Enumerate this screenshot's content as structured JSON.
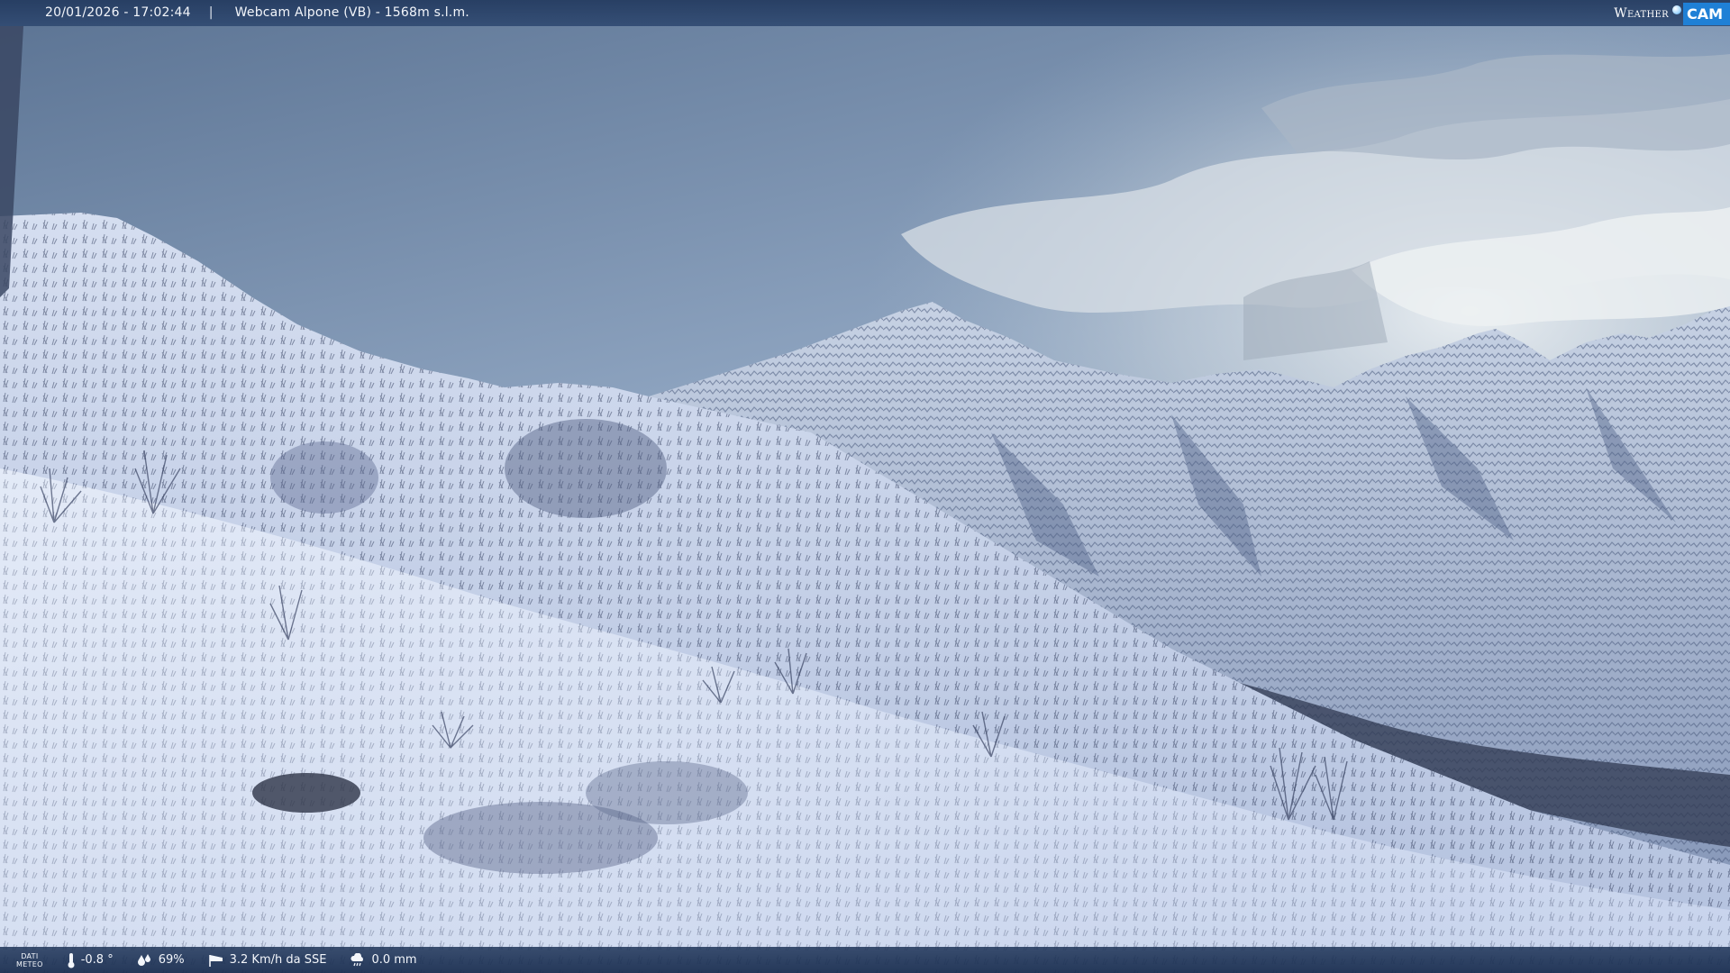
{
  "header": {
    "timestamp": "20/01/2026 - 17:02:44",
    "separator": "|",
    "title": "Webcam Alpone (VB) - 1568m s.l.m."
  },
  "brand": {
    "weather": "Weather",
    "cam": "CAM"
  },
  "footer": {
    "dati_line1": "DATI",
    "dati_line2": "METEO",
    "temperature": "-0.8 °",
    "humidity": "69%",
    "wind": "3.2 Km/h da SSE",
    "rain": "0.0 mm"
  },
  "icons": {
    "temperature": "thermometer-icon",
    "humidity": "droplets-icon",
    "wind": "windsock-icon",
    "rain": "rain-cloud-icon"
  },
  "colors": {
    "bar_bg": "#233a5f",
    "text": "#f3f6fb",
    "brand_accent": "#1f80d6",
    "sky_top": "#5f7696",
    "snow": "#dfe8f6"
  }
}
